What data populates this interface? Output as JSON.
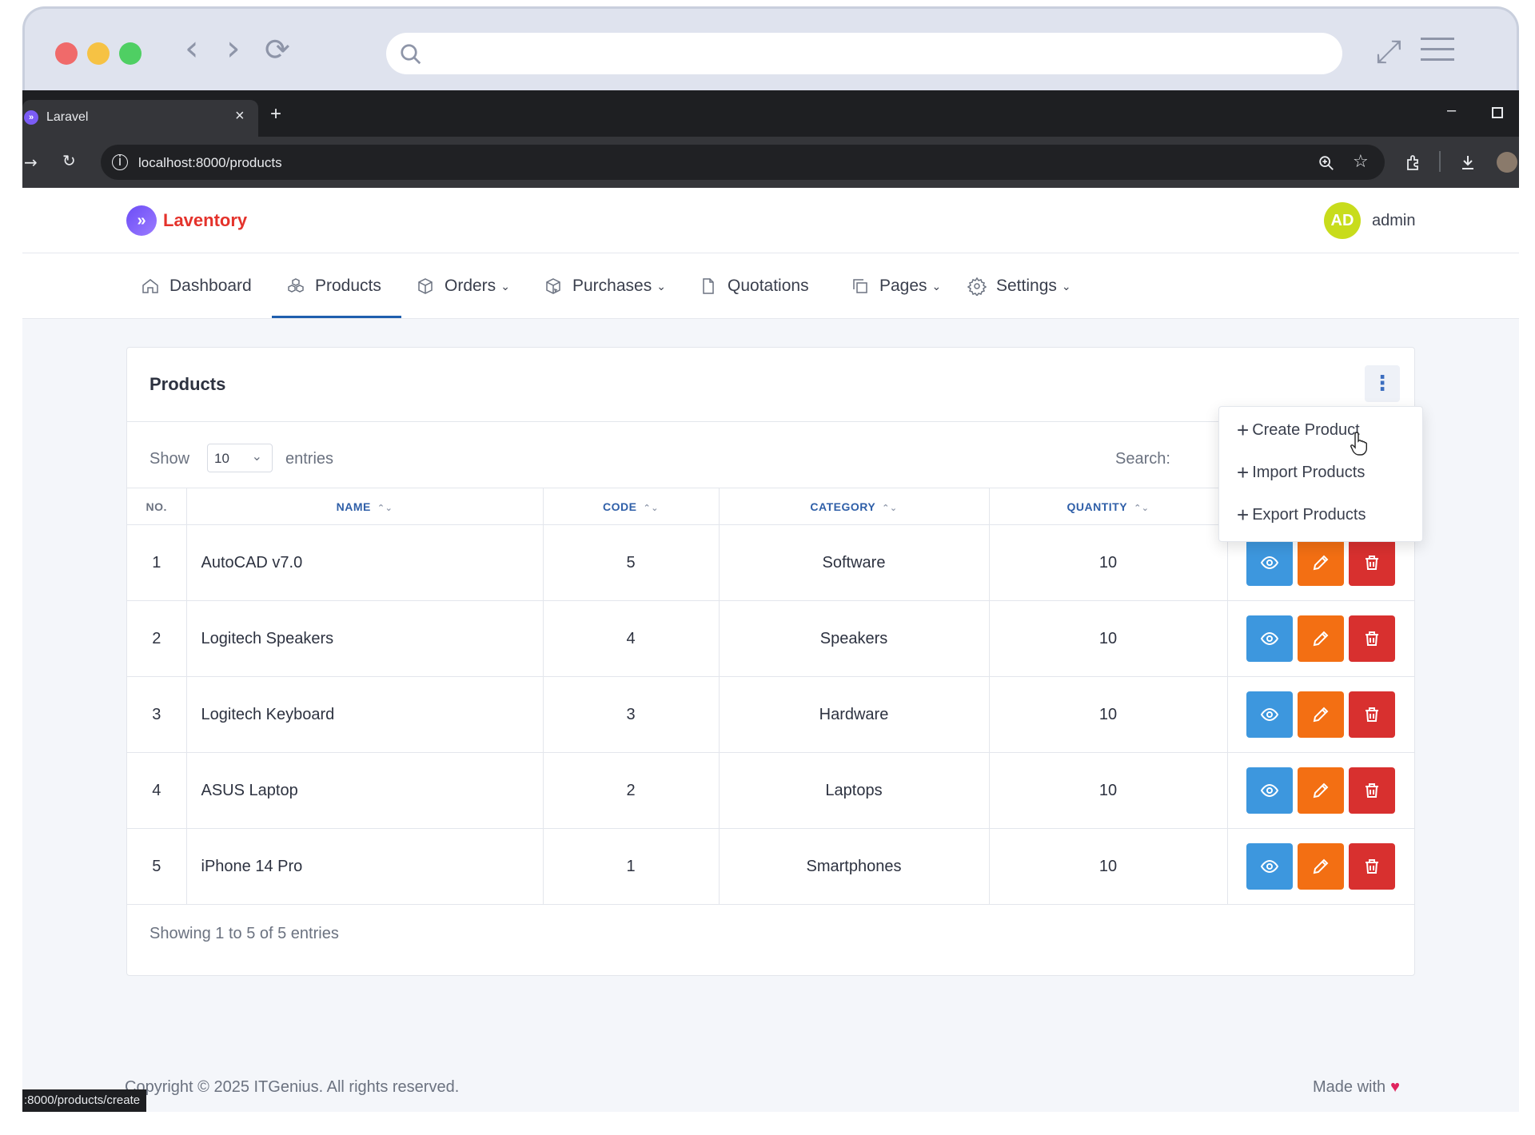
{
  "browser": {
    "tab_title": "Laravel",
    "tab_close": "×",
    "new_tab": "+",
    "url": "localhost:8000/products",
    "status_url": ":8000/products/create"
  },
  "app": {
    "brand": "Laventory",
    "user_initials": "AD",
    "username": "admin"
  },
  "menu": {
    "items": [
      {
        "label": "Dashboard",
        "icon": "home-icon"
      },
      {
        "label": "Products",
        "icon": "boxes-icon"
      },
      {
        "label": "Orders",
        "icon": "box-icon"
      },
      {
        "label": "Purchases",
        "icon": "box-return-icon"
      },
      {
        "label": "Quotations",
        "icon": "file-icon"
      },
      {
        "label": "Pages",
        "icon": "copy-icon"
      },
      {
        "label": "Settings",
        "icon": "gear-icon"
      }
    ],
    "active": "Products"
  },
  "products_card": {
    "title": "Products",
    "kebab": "⋮",
    "show_label": "Show",
    "page_size": "10",
    "entries_label": "entries",
    "search_label": "Search:",
    "columns": [
      "NO.",
      "NAME",
      "CODE",
      "CATEGORY",
      "QUANTITY"
    ],
    "rows": [
      {
        "no": "1",
        "name": "AutoCAD v7.0",
        "code": "5",
        "category": "Software",
        "quantity": "10"
      },
      {
        "no": "2",
        "name": "Logitech Speakers",
        "code": "4",
        "category": "Speakers",
        "quantity": "10"
      },
      {
        "no": "3",
        "name": "Logitech Keyboard",
        "code": "3",
        "category": "Hardware",
        "quantity": "10"
      },
      {
        "no": "4",
        "name": "ASUS Laptop",
        "code": "2",
        "category": "Laptops",
        "quantity": "10"
      },
      {
        "no": "5",
        "name": "iPhone 14 Pro",
        "code": "1",
        "category": "Smartphones",
        "quantity": "10"
      }
    ],
    "showing": "Showing 1 to 5 of 5 entries"
  },
  "dropdown": {
    "items": [
      "Create Product",
      "Import Products",
      "Export Products"
    ]
  },
  "footer": {
    "copyright": "Copyright © 2025 ITGenius. All rights reserved.",
    "made_with": "Made with"
  },
  "colors": {
    "view": "#3d97de",
    "edit": "#f36f13",
    "delete": "#d8302f",
    "brand": "#e4322b",
    "accent": "#1f5fae"
  }
}
